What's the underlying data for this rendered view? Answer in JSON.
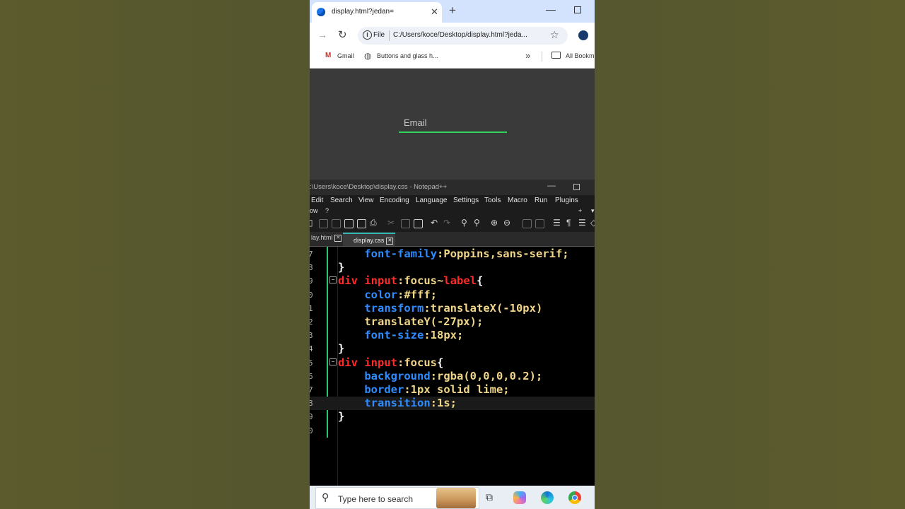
{
  "browser": {
    "tab_title": "display.html?jedan=",
    "tab_close": "✕",
    "new_tab": "+",
    "minimize": "—",
    "address_chip": "File",
    "url": "C:/Users/koce/Desktop/display.html?jeda...",
    "bookmarks": {
      "gmail_icon": "M",
      "gmail": "Gmail",
      "buttons": "Buttons and glass h...",
      "more": "»",
      "all": "All Bookm"
    }
  },
  "page": {
    "email_label": "Email",
    "accent_color": "#32d35a"
  },
  "notepad": {
    "title": ":\\Users\\koce\\Desktop\\display.css - Notepad++",
    "menu": [
      "Edit",
      "Search",
      "View",
      "Encoding",
      "Language",
      "Settings",
      "Tools",
      "Macro",
      "Run",
      "Plugins"
    ],
    "menu_row2": [
      "ow",
      "?",
      "+",
      "▾"
    ],
    "tabs": [
      {
        "label": "lay.html",
        "active": false
      },
      {
        "label": "display.css",
        "active": true
      }
    ],
    "lines": [
      {
        "num": "7",
        "code": [
          {
            "t": "font-family",
            "c": "prop"
          },
          {
            "t": ":Poppins,sans-serif;",
            "c": "val"
          }
        ],
        "indent": true
      },
      {
        "num": "8",
        "code": [
          {
            "t": "}",
            "c": "br"
          }
        ],
        "indent": false
      },
      {
        "num": "9",
        "fold": "−",
        "code": [
          {
            "t": "div ",
            "c": "sel"
          },
          {
            "t": "input",
            "c": "sel"
          },
          {
            "t": ":focus~",
            "c": "pseudo"
          },
          {
            "t": "label",
            "c": "lbl"
          },
          {
            "t": "{",
            "c": "br"
          }
        ],
        "indent": false
      },
      {
        "num": "0",
        "code": [
          {
            "t": "color",
            "c": "prop"
          },
          {
            "t": ":#fff;",
            "c": "val"
          }
        ],
        "indent": true
      },
      {
        "num": "1",
        "code": [
          {
            "t": "transform",
            "c": "prop"
          },
          {
            "t": ":translateX(-10px)",
            "c": "val"
          }
        ],
        "indent": true
      },
      {
        "num": "2",
        "code": [
          {
            "t": "translateY(-27px);",
            "c": "val"
          }
        ],
        "indent": true
      },
      {
        "num": "3",
        "code": [
          {
            "t": "font-size",
            "c": "prop"
          },
          {
            "t": ":18px;",
            "c": "val"
          }
        ],
        "indent": true
      },
      {
        "num": "4",
        "code": [
          {
            "t": "}",
            "c": "br"
          }
        ],
        "indent": false
      },
      {
        "num": "5",
        "fold": "−",
        "code": [
          {
            "t": "div ",
            "c": "sel"
          },
          {
            "t": "input",
            "c": "sel"
          },
          {
            "t": ":focus",
            "c": "pseudo"
          },
          {
            "t": "{",
            "c": "br"
          }
        ],
        "indent": false
      },
      {
        "num": "6",
        "code": [
          {
            "t": "background",
            "c": "prop"
          },
          {
            "t": ":rgba(0,0,0,0.2);",
            "c": "val"
          }
        ],
        "indent": true
      },
      {
        "num": "7",
        "code": [
          {
            "t": "border",
            "c": "prop"
          },
          {
            "t": ":1px solid lime;",
            "c": "val"
          }
        ],
        "indent": true
      },
      {
        "num": "8",
        "code": [
          {
            "t": "transition",
            "c": "prop"
          },
          {
            "t": ":1s;",
            "c": "val"
          }
        ],
        "indent": true,
        "current": true
      },
      {
        "num": "9",
        "code": [
          {
            "t": "}",
            "c": "br"
          }
        ],
        "indent": false
      },
      {
        "num": "0",
        "code": [],
        "indent": false
      }
    ]
  },
  "taskbar": {
    "search_placeholder": "Type here to search",
    "search_icon": "⚲",
    "task_view_icon": "⧉"
  }
}
